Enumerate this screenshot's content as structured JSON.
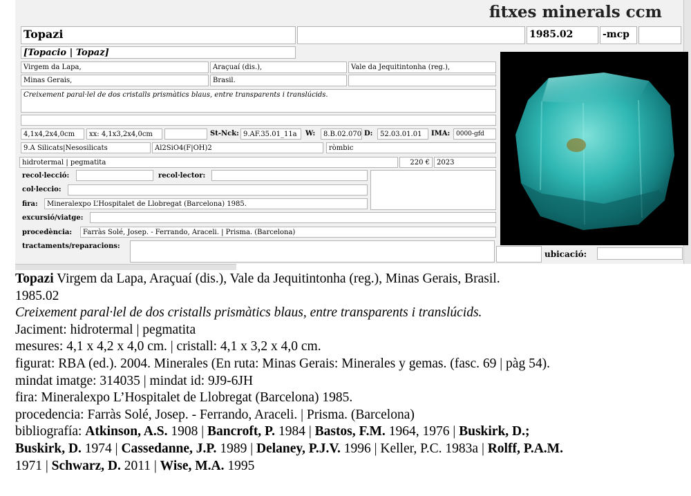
{
  "header": {
    "title": "fitxes minerals ccm"
  },
  "card": {
    "name": "Topazi",
    "code": "1985.02",
    "suffix": "-mcp",
    "synonyms": "[Topacio | Topaz]",
    "locality": "Virgem da Lapa,",
    "district": "Araçuaí (dis.),",
    "region": "Vale da Jequitintonha (reg.),",
    "state": "Minas Gerais,",
    "country": "Brasil.",
    "description": "Creixement paral·lel de dos cristalls prismàtics blaus, entre transparents i translúcids.",
    "measures": "4,1x4,2x4,0cm",
    "crystal": "xx: 4,1x3,2x4,0cm",
    "strunz_label": "St-Nck:",
    "strunz": "9.AF.35.01_11a",
    "w_label": "W:",
    "w": "8.B.02.070",
    "d_label": "D:",
    "d": "52.03.01.01",
    "ima_label": "IMA:",
    "ima": "0000-gfd",
    "class": "9.A Silicats|Nesosilicats",
    "formula": "Al2SiO4(F|OH)2",
    "system": "ròmbic",
    "genesis": "hidrotermal | pegmatita",
    "price": "220 €",
    "year": "2023",
    "recoleccio_label": "recol·lecció:",
    "recollector_label": "recol·lector:",
    "colleccio_label": "col·leccio:",
    "fira_label": "fira:",
    "fira": "Mineralexpo L’Hospitalet de Llobregat (Barcelona) 1985.",
    "excursio_label": "excursió/viatge:",
    "procedencia_label": "procedència:",
    "procedencia": "Farràs Solé, Josep. - Ferrando, Araceli. | Prisma. (Barcelona)",
    "tractaments_label": "tractaments/reparacions:",
    "ubicacio_label": "ubicació:"
  },
  "caption": {
    "name": "Topazi",
    "locality_line": " Virgem da Lapa, Araçuaí (dis.), Vale da Jequitintonha (reg.), Minas Gerais, Brasil.",
    "code": "1985.02",
    "description": "Creixement paral·lel de dos cristalls prismàtics blaus, entre transparents i translúcids.",
    "jaciment": "Jaciment: hidrotermal | pegmatita",
    "mesures": "mesures: 4,1 x 4,2 x 4,0 cm. | cristall: 4,1 x 3,2 x 4,0 cm.",
    "figurat": "figurat: RBA (ed.). 2004. Minerales (En ruta: Minas Gerais: Minerales y gemas. (fasc. 69 | pàg 54).",
    "mindat": "mindat imatge: 314035 | mindat id: 9J9-6JH",
    "fira": "fira: Mineralexpo L’Hospitalet de Llobregat (Barcelona) 1985.",
    "procedencia": "procedencia: Farràs Solé, Josep. - Ferrando, Araceli. | Prisma. (Barcelona)",
    "bib_label": "bibliografía: ",
    "bib": {
      "a1": "Atkinson, A.S.",
      "y1": " 1908 | ",
      "a2": "Bancroft, P.",
      "y2": " 1984 | ",
      "a3": "Bastos, F.M.",
      "y3": " 1964, 1976 | ",
      "a4": "Buskirk, D.;",
      "a5": "Buskirk, D.",
      "y5": " 1974 | ",
      "a6": "Cassedanne, J.P.",
      "y6": " 1989 | ",
      "a7": "Delaney, P.J.V.",
      "y7": " 1996 | Keller, P.C. 1983a | ",
      "a8": "Rolff, P.A.M.",
      "y8": "1971 | ",
      "a9": "Schwarz, D.",
      "y9": " 2011 | ",
      "a10": "Wise, M.A.",
      "y10": " 1995"
    }
  }
}
